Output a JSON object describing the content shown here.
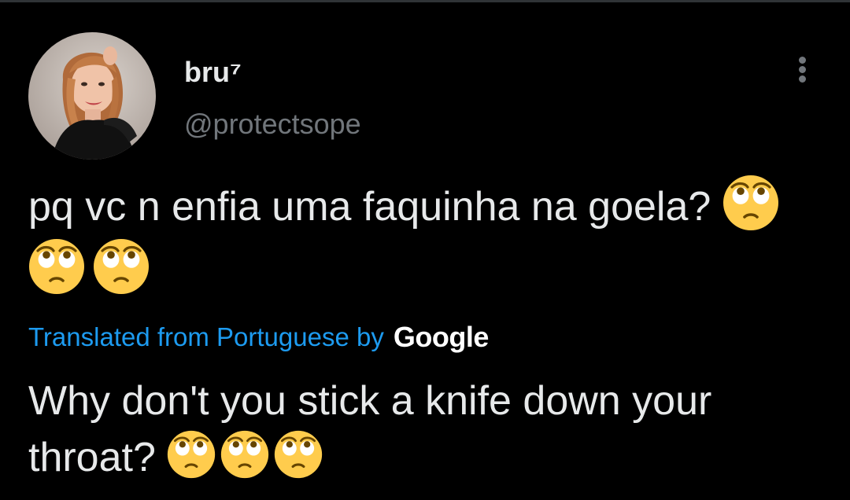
{
  "tweet": {
    "author": {
      "display_name": "bru⁷",
      "handle": "@protectsope",
      "avatar_icon": "profile-photo-woman-black-dress"
    },
    "more_icon": "more-vertical-icon",
    "text_main": "pq vc n enfia uma faquinha na goela?",
    "emoji_name": "face-with-rolling-eyes",
    "emoji_count": 3,
    "translation": {
      "label": "Translated from Portuguese by",
      "provider": "Google",
      "text": "Why don't you stick a knife down your throat?"
    }
  },
  "colors": {
    "background": "#000000",
    "text_primary": "#e7e9ea",
    "text_secondary": "#71767b",
    "link": "#1d9bf0",
    "emoji_fill": "#ffcc4d"
  }
}
